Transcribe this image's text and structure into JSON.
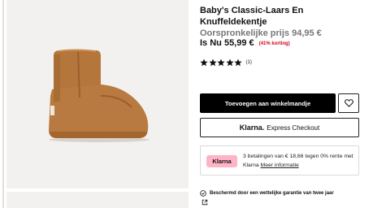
{
  "product": {
    "title": "Baby's Classic-Laars En Knuffeldekentje",
    "original_price_label": "Oorspronkelijke prijs 94,95 €",
    "now_price_label": "Is Nu 55,99 €",
    "discount_label": "(41% korting)",
    "rating": 5,
    "rating_count": "(1)"
  },
  "actions": {
    "add_to_cart": "Toevoegen aan winkelmandje",
    "klarna_brand": "Klarna.",
    "express_checkout": "Express Checkout"
  },
  "klarna": {
    "badge": "Klarna",
    "installments_text": "3 betalingen van € 18,66 tegen 0% rente met Klarna",
    "more_info": "Meer informatie"
  },
  "guarantee": {
    "text": "Beschermd door een wettelijke garantie van twee jaar"
  },
  "colors": {
    "accent": "#000000",
    "discount": "#d0021b",
    "klarna_pink": "#ffb3c7",
    "gallery_bg": "#f2f1ef"
  },
  "icons": {
    "wishlist": "heart-icon",
    "guarantee": "shield-check-icon",
    "external": "external-link-icon",
    "rating": "star-icon"
  }
}
